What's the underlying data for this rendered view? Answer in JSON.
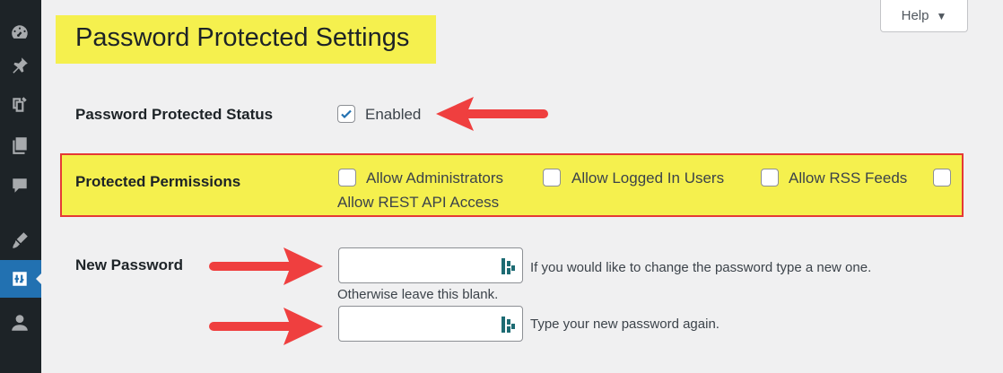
{
  "sidebar": {
    "icons": [
      "dashboard-icon",
      "pin-icon",
      "media-icon",
      "pages-icon",
      "comments-icon",
      "appearance-icon",
      "settings-icon",
      "users-icon"
    ],
    "active": "settings-icon"
  },
  "help": {
    "label": "Help",
    "caret": "▼"
  },
  "page": {
    "title": "Password Protected Settings"
  },
  "status": {
    "label": "Password Protected Status",
    "checkbox_label": "Enabled",
    "checked": true
  },
  "permissions": {
    "label": "Protected Permissions",
    "options": [
      {
        "label": "Allow Administrators",
        "checked": false
      },
      {
        "label": "Allow Logged In Users",
        "checked": false
      },
      {
        "label": "Allow RSS Feeds",
        "checked": false
      },
      {
        "label": "Allow REST API Access",
        "checked": false
      }
    ]
  },
  "new_password": {
    "label": "New Password",
    "field1_value": "",
    "field1_desc": "If you would like to change the password type a new one.",
    "field1_desc2": "Otherwise leave this blank.",
    "field2_value": "",
    "field2_desc": "Type your new password again."
  },
  "colors": {
    "highlight": "#f5f04e",
    "annotation_red": "#ef3f3f",
    "accent": "#2271b1",
    "sidebar": "#1d2327"
  }
}
